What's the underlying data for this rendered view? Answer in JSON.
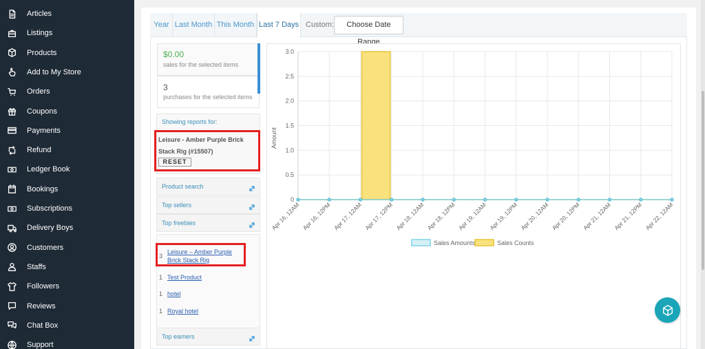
{
  "sidebar": {
    "items": [
      {
        "label": "Articles",
        "icon": "document-icon"
      },
      {
        "label": "Listings",
        "icon": "briefcase-icon"
      },
      {
        "label": "Products",
        "icon": "cube-icon"
      },
      {
        "label": "Add to My Store",
        "icon": "hand-pointer-icon"
      },
      {
        "label": "Orders",
        "icon": "cart-icon"
      },
      {
        "label": "Coupons",
        "icon": "gift-icon"
      },
      {
        "label": "Payments",
        "icon": "credit-card-icon"
      },
      {
        "label": "Refund",
        "icon": "retweet-icon"
      },
      {
        "label": "Ledger Book",
        "icon": "money-icon"
      },
      {
        "label": "Bookings",
        "icon": "calendar-icon"
      },
      {
        "label": "Subscriptions",
        "icon": "money-icon"
      },
      {
        "label": "Delivery Boys",
        "icon": "truck-icon"
      },
      {
        "label": "Customers",
        "icon": "user-circle-icon"
      },
      {
        "label": "Staffs",
        "icon": "user-icon"
      },
      {
        "label": "Followers",
        "icon": "shirt-icon"
      },
      {
        "label": "Reviews",
        "icon": "comment-icon"
      },
      {
        "label": "Chat Box",
        "icon": "comments-icon"
      },
      {
        "label": "Support",
        "icon": "globe-icon"
      }
    ]
  },
  "tabs": [
    {
      "label": "Year"
    },
    {
      "label": "Last Month"
    },
    {
      "label": "This Month"
    },
    {
      "label": "Last 7 Days",
      "active": true
    }
  ],
  "custom_label": "Custom:",
  "date_range_button": "Choose Date Range",
  "stats": [
    {
      "value": "$0.00",
      "label": "sales for the selected items",
      "color": "#4caf50"
    },
    {
      "value": "3",
      "label": "purchases for the selected items",
      "color": "#555555"
    }
  ],
  "reports": {
    "heading": "Showing reports for:",
    "title": "Leisure - Amber Purple Brick Stack Rig (#15507)",
    "reset_label": "RESET"
  },
  "accordion": [
    {
      "label": "Product search"
    },
    {
      "label": "Top sellers"
    },
    {
      "label": "Top freebies"
    }
  ],
  "top_freebies": [
    {
      "count": "3",
      "name": "Leisure – Amber Purple Brick Stack Rig"
    },
    {
      "count": "1",
      "name": "Test Product"
    },
    {
      "count": "1",
      "name": "hotel"
    },
    {
      "count": "1",
      "name": "Royal hotel"
    }
  ],
  "top_earners_label": "Top earners",
  "chart_data": {
    "type": "bar",
    "ylabel": "Amount",
    "xlabel": "",
    "ylim": [
      0,
      3.0
    ],
    "yticks": [
      "0",
      "0.5",
      "1.0",
      "1.5",
      "2.0",
      "2.5",
      "3.0"
    ],
    "x_labels": [
      "Apr 16, 12AM",
      "Apr 16, 12PM",
      "Apr 17, 12AM",
      "Apr 17, 12PM",
      "Apr 18, 12AM",
      "Apr 18, 12PM",
      "Apr 19, 12AM",
      "Apr 19, 12PM",
      "Apr 20, 12AM",
      "Apr 20, 12PM",
      "Apr 21, 12AM",
      "Apr 21, 12PM",
      "Apr 22, 12AM"
    ],
    "grid": true,
    "legend_position": "bottom",
    "series": [
      {
        "name": "Sales Amounts",
        "kind": "line",
        "color": "#7fd3e6",
        "values": [
          0,
          0,
          0,
          0,
          0,
          0,
          0,
          0,
          0,
          0,
          0,
          0,
          0
        ]
      },
      {
        "name": "Sales Counts",
        "kind": "bar",
        "color": "#f9e27d",
        "border": "#e8c43a",
        "values": [
          0,
          0,
          3,
          0,
          0,
          0,
          0,
          0,
          0,
          0,
          0,
          0,
          0
        ]
      }
    ]
  }
}
